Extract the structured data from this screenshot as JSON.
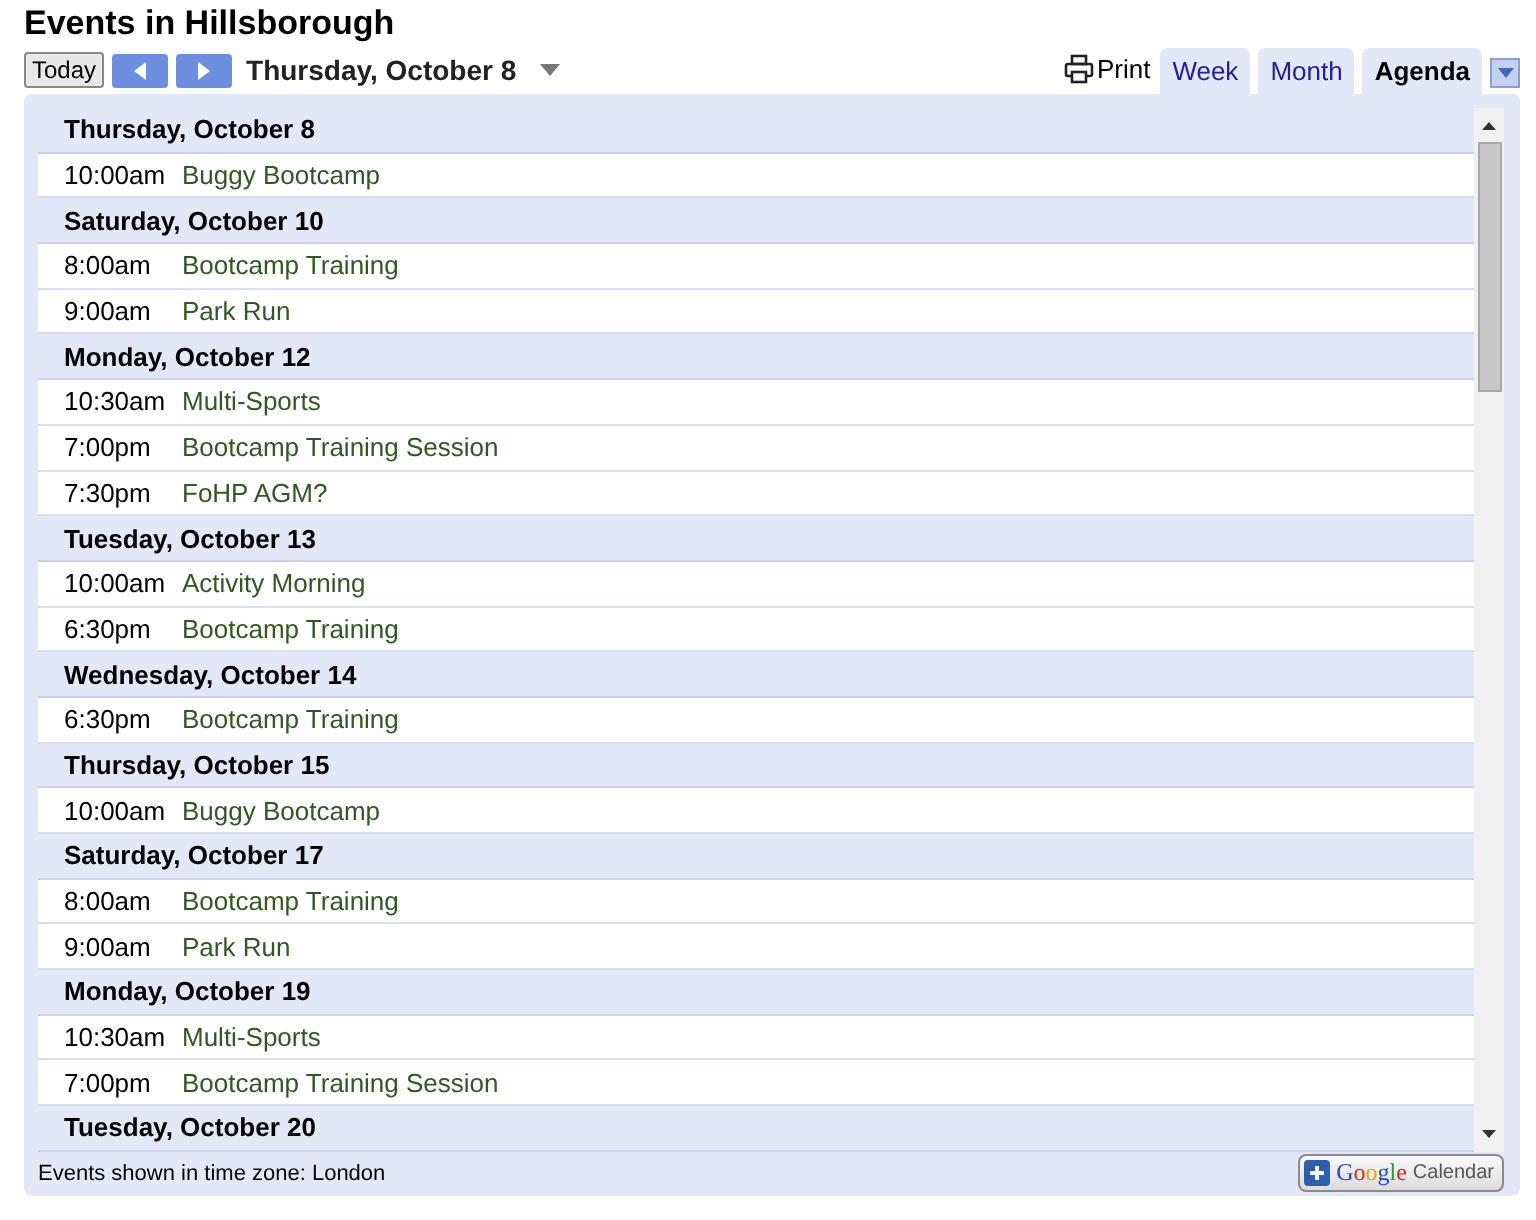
{
  "title": "Events in Hillsborough",
  "toolbar": {
    "today": "Today",
    "date": "Thursday, October 8",
    "print": "Print"
  },
  "tabs": [
    {
      "label": "Week",
      "selected": false
    },
    {
      "label": "Month",
      "selected": false
    },
    {
      "label": "Agenda",
      "selected": true
    }
  ],
  "agenda": [
    {
      "day": "Thursday, October 8",
      "events": [
        {
          "time": "10:00am",
          "title": "Buggy Bootcamp"
        }
      ]
    },
    {
      "day": "Saturday, October 10",
      "events": [
        {
          "time": "8:00am",
          "title": "Bootcamp Training"
        },
        {
          "time": "9:00am",
          "title": "Park Run"
        }
      ]
    },
    {
      "day": "Monday, October 12",
      "events": [
        {
          "time": "10:30am",
          "title": "Multi-Sports"
        },
        {
          "time": "7:00pm",
          "title": "Bootcamp Training Session"
        },
        {
          "time": "7:30pm",
          "title": "FoHP AGM?"
        }
      ]
    },
    {
      "day": "Tuesday, October 13",
      "events": [
        {
          "time": "10:00am",
          "title": "Activity Morning"
        },
        {
          "time": "6:30pm",
          "title": "Bootcamp Training"
        }
      ]
    },
    {
      "day": "Wednesday, October 14",
      "events": [
        {
          "time": "6:30pm",
          "title": "Bootcamp Training"
        }
      ]
    },
    {
      "day": "Thursday, October 15",
      "events": [
        {
          "time": "10:00am",
          "title": "Buggy Bootcamp"
        }
      ]
    },
    {
      "day": "Saturday, October 17",
      "events": [
        {
          "time": "8:00am",
          "title": "Bootcamp Training"
        },
        {
          "time": "9:00am",
          "title": "Park Run"
        }
      ]
    },
    {
      "day": "Monday, October 19",
      "events": [
        {
          "time": "10:30am",
          "title": "Multi-Sports"
        },
        {
          "time": "7:00pm",
          "title": "Bootcamp Training Session"
        }
      ]
    },
    {
      "day": "Tuesday, October 20"
    }
  ],
  "footer": {
    "timezone": "Events shown in time zone: London",
    "badge_brand": "Google",
    "badge_label": "Calendar"
  }
}
